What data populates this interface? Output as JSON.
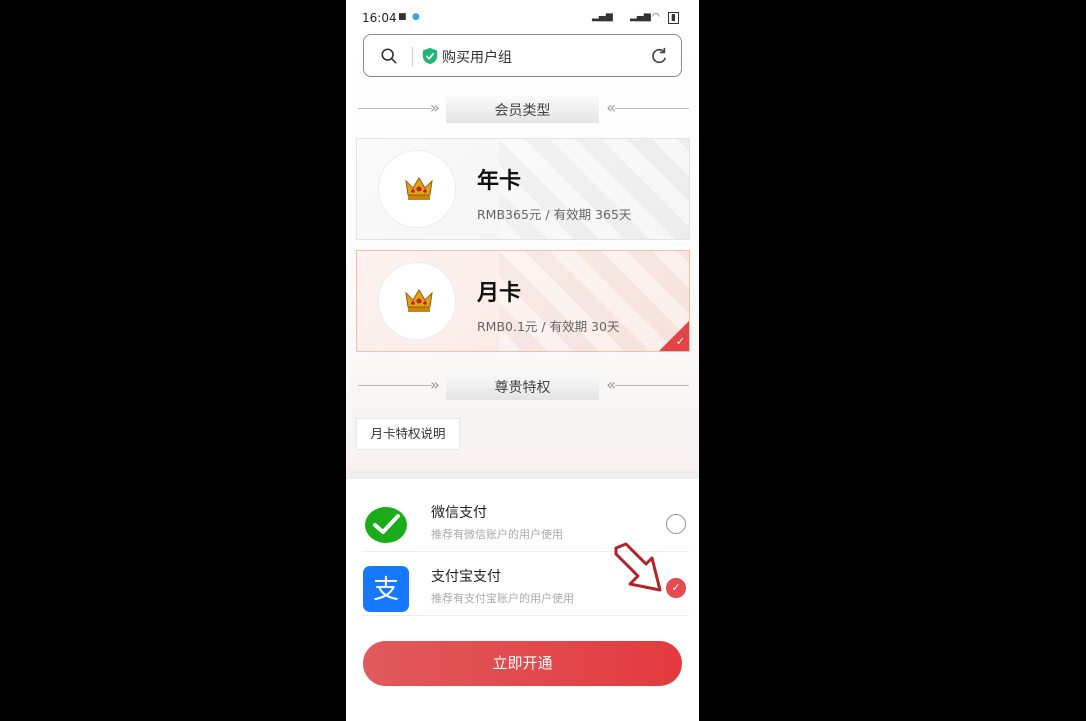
{
  "status_bar": {
    "time": "16:04"
  },
  "search": {
    "title": "购买用户组"
  },
  "membership": {
    "section_title": "会员类型",
    "plans": [
      {
        "name": "年卡",
        "desc": "RMB365元 / 有效期 365天",
        "selected": false
      },
      {
        "name": "月卡",
        "desc": "RMB0.1元 / 有效期 30天",
        "selected": true
      }
    ]
  },
  "privileges": {
    "section_title": "尊贵特权",
    "button_label": "月卡特权说明"
  },
  "payment": {
    "methods": [
      {
        "name": "微信支付",
        "desc": "推荐有微信账户的用户使用",
        "checked": false
      },
      {
        "name": "支付宝支付",
        "desc": "推荐有支付宝账户的用户使用",
        "checked": true
      }
    ]
  },
  "cta": {
    "label": "立即开通"
  },
  "colors": {
    "accent": "#e33a3f",
    "wechat": "#1aad19",
    "alipay": "#1678ff"
  }
}
